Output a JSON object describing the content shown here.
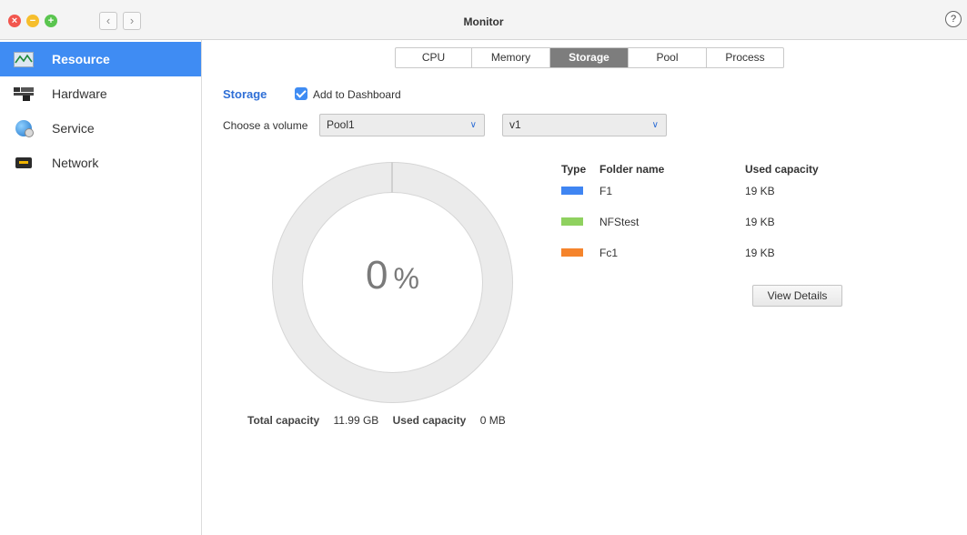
{
  "window": {
    "title": "Monitor",
    "help_label": "?"
  },
  "sidebar": {
    "items": [
      {
        "label": "Resource",
        "icon": "resource-monitor-icon",
        "active": true
      },
      {
        "label": "Hardware",
        "icon": "hardware-icon",
        "active": false
      },
      {
        "label": "Service",
        "icon": "service-globe-icon",
        "active": false
      },
      {
        "label": "Network",
        "icon": "network-adapter-icon",
        "active": false
      }
    ]
  },
  "tabs": [
    {
      "label": "CPU",
      "active": false
    },
    {
      "label": "Memory",
      "active": false
    },
    {
      "label": "Storage",
      "active": true
    },
    {
      "label": "Pool",
      "active": false
    },
    {
      "label": "Process",
      "active": false
    }
  ],
  "storage": {
    "section_title": "Storage",
    "add_to_dashboard_label": "Add to Dashboard",
    "add_to_dashboard_checked": true,
    "choose_volume_label": "Choose a volume",
    "pool_select_value": "Pool1",
    "volume_select_value": "v1",
    "usage_percent": "0",
    "usage_unit": "%",
    "total_capacity_label": "Total capacity",
    "total_capacity_value": "11.99 GB",
    "used_capacity_label": "Used capacity",
    "used_capacity_value": "0 MB"
  },
  "folders": {
    "headers": {
      "type": "Type",
      "name": "Folder name",
      "used": "Used capacity"
    },
    "rows": [
      {
        "color": "#3f85f2",
        "name": "F1",
        "used": "19 KB"
      },
      {
        "color": "#8fd15f",
        "name": "NFStest",
        "used": "19 KB"
      },
      {
        "color": "#f5842c",
        "name": "Fc1",
        "used": "19 KB"
      }
    ],
    "view_details_label": "View Details"
  },
  "colors": {
    "accent": "#3f8cf3",
    "active_tab": "#7d7d7d",
    "section_title": "#2f6fd6"
  }
}
